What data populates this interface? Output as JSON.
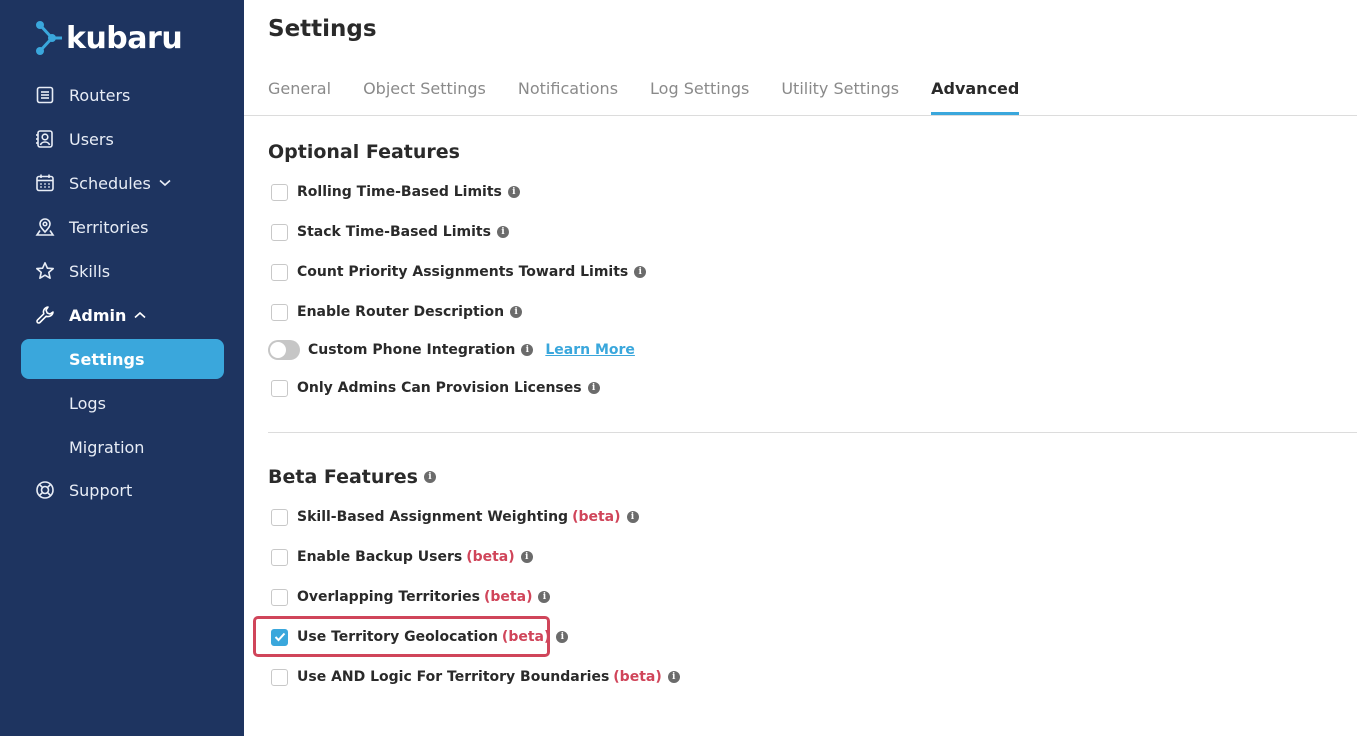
{
  "app": {
    "logo_text": "kubaru"
  },
  "sidebar": {
    "items": [
      {
        "label": "Routers",
        "icon": "list-icon"
      },
      {
        "label": "Users",
        "icon": "user-badge-icon"
      },
      {
        "label": "Schedules",
        "icon": "calendar-icon"
      },
      {
        "label": "Territories",
        "icon": "map-pin-icon"
      },
      {
        "label": "Skills",
        "icon": "star-icon"
      },
      {
        "label": "Admin",
        "icon": "wrench-icon"
      },
      {
        "label": "Settings"
      },
      {
        "label": "Logs"
      },
      {
        "label": "Migration"
      },
      {
        "label": "Support",
        "icon": "lifebuoy-icon"
      }
    ],
    "active_color": "#3aa7dc",
    "background": "#1e3460"
  },
  "page": {
    "title": "Settings"
  },
  "tabs": [
    {
      "label": "General"
    },
    {
      "label": "Object Settings"
    },
    {
      "label": "Notifications"
    },
    {
      "label": "Log Settings"
    },
    {
      "label": "Utility Settings"
    },
    {
      "label": "Advanced",
      "active": true
    }
  ],
  "optional": {
    "title": "Optional Features",
    "items": [
      {
        "label": "Rolling Time-Based Limits",
        "checked": false
      },
      {
        "label": "Stack Time-Based Limits",
        "checked": false
      },
      {
        "label": "Count Priority Assignments Toward Limits",
        "checked": false
      },
      {
        "label": "Enable Router Description",
        "checked": false
      },
      {
        "label": "Custom Phone Integration",
        "toggle": false,
        "link": "Learn More"
      },
      {
        "label": "Only Admins Can Provision Licenses",
        "checked": false
      }
    ]
  },
  "beta": {
    "title": "Beta Features",
    "tag": "(beta)",
    "items": [
      {
        "label": "Skill-Based Assignment Weighting",
        "checked": false
      },
      {
        "label": "Enable Backup Users",
        "checked": false
      },
      {
        "label": "Overlapping Territories",
        "checked": false
      },
      {
        "label": "Use Territory Geolocation",
        "checked": true
      },
      {
        "label": "Use AND Logic For Territory Boundaries",
        "checked": false
      }
    ]
  },
  "colors": {
    "accent": "#3aa7dc",
    "beta": "#d0455a",
    "highlight": "#d0455a"
  }
}
